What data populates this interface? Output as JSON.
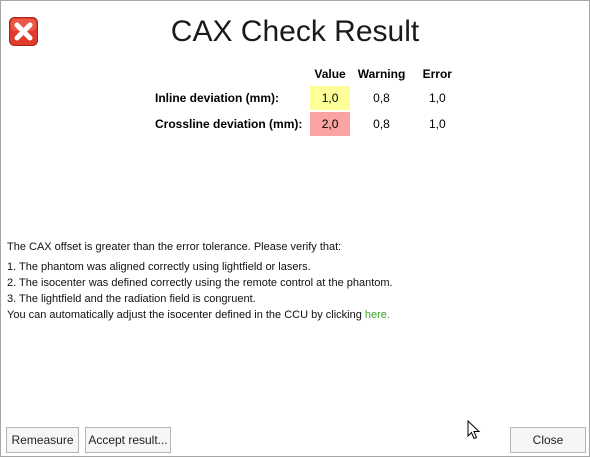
{
  "dialog": {
    "title": "CAX Check Result",
    "status_icon": "error-x-icon",
    "icon_color": "#e03c2b"
  },
  "results": {
    "headers": {
      "value": "Value",
      "warning": "Warning",
      "error": "Error"
    },
    "rows": [
      {
        "label": "Inline deviation (mm):",
        "value": "1,0",
        "warning": "0,8",
        "error": "1,0",
        "value_color": "#ffff99"
      },
      {
        "label": "Crossline deviation (mm):",
        "value": "2,0",
        "warning": "0,8",
        "error": "1,0",
        "value_color": "#f9a3a3"
      }
    ]
  },
  "message": {
    "intro": "The CAX offset is greater than the error tolerance. Please verify that:",
    "items": [
      "1. The phantom was aligned correctly using lightfield or lasers.",
      "2. The isocenter was defined correctly using the remote control at the phantom.",
      "3. The lightfield and the radiation field is congruent."
    ],
    "adjust_text": "You can automatically adjust the isocenter defined in the CCU by clicking ",
    "link_label": "here."
  },
  "buttons": {
    "remeasure": "Remeasure",
    "accept": "Accept result...",
    "close": "Close"
  }
}
